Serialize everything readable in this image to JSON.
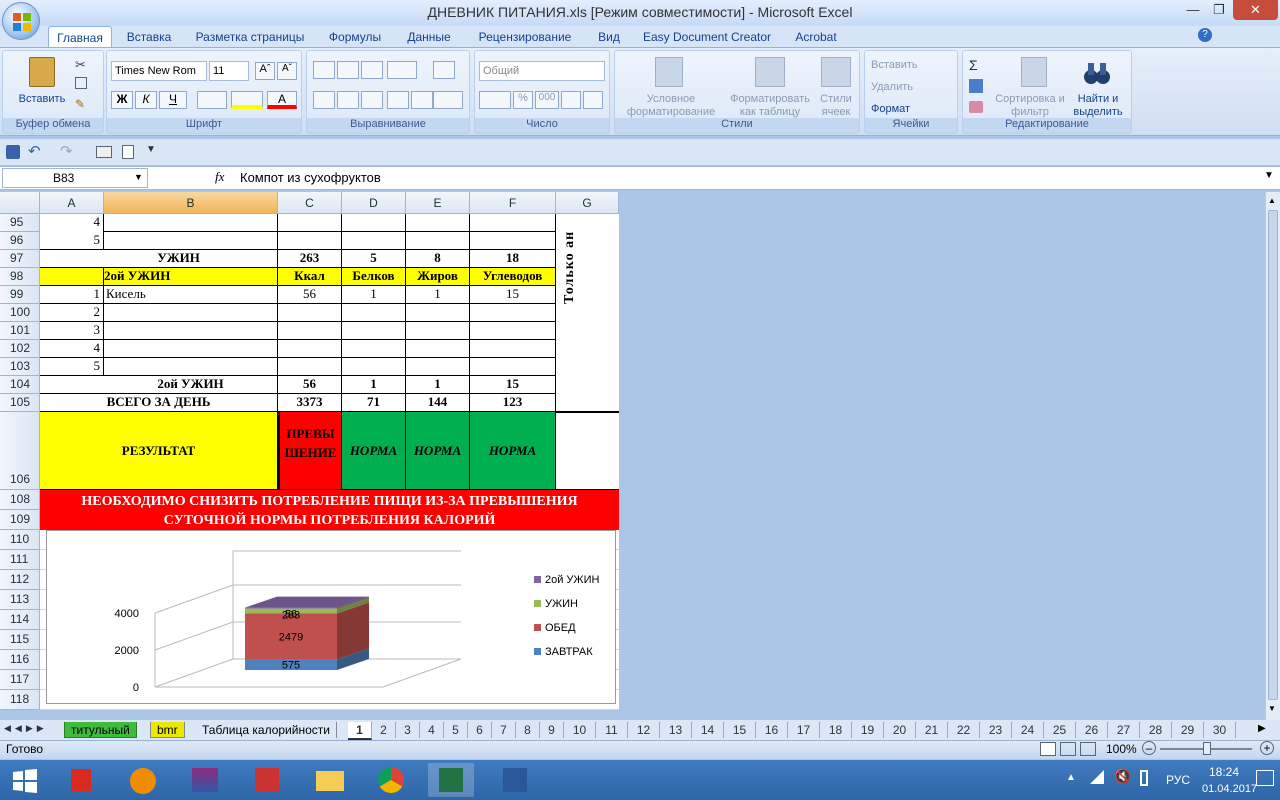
{
  "window": {
    "title": "ДНЕВНИК ПИТАНИЯ.xls  [Режим совместимости] - Microsoft Excel"
  },
  "tabs": [
    "Главная",
    "Вставка",
    "Разметка страницы",
    "Формулы",
    "Данные",
    "Рецензирование",
    "Вид",
    "Easy Document Creator",
    "Acrobat"
  ],
  "ribbon": {
    "paste": "Вставить",
    "clipboard": "Буфер обмена",
    "font_name": "Times New Rom",
    "font_size": "11",
    "font_group": "Шрифт",
    "align_group": "Выравнивание",
    "number_format": "Общий",
    "number_group": "Число",
    "cond_format": "Условное форматирование",
    "format_table": "Форматировать как таблицу",
    "cell_styles": "Стили ячеек",
    "styles_group": "Стили",
    "insert": "Вставить",
    "delete": "Удалить",
    "format": "Формат",
    "cells_group": "Ячейки",
    "sort_filter": "Сортировка и фильтр",
    "find_select": "Найти и выделить",
    "editing_group": "Редактирование"
  },
  "formula_bar": {
    "name_box": "B83",
    "fx": "fx",
    "content": "Компот из сухофруктов"
  },
  "columns": [
    "A",
    "B",
    "C",
    "D",
    "E",
    "F",
    "G"
  ],
  "rows": {
    "r95": {
      "num": "95",
      "a": "4"
    },
    "r96": {
      "num": "96",
      "a": "5"
    },
    "r97": {
      "num": "97",
      "b": "УЖИН",
      "c": "263",
      "d": "5",
      "e": "8",
      "f": "18"
    },
    "r98": {
      "num": "98",
      "b": "2ой УЖИН",
      "c": "Ккал",
      "d": "Белков",
      "e": "Жиров",
      "f": "Углеводов"
    },
    "r99": {
      "num": "99",
      "a": "1",
      "b": "Кисель",
      "c": "56",
      "d": "1",
      "e": "1",
      "f": "15"
    },
    "r100": {
      "num": "100",
      "a": "2"
    },
    "r101": {
      "num": "101",
      "a": "3"
    },
    "r102": {
      "num": "102",
      "a": "4"
    },
    "r103": {
      "num": "103",
      "a": "5"
    },
    "r104": {
      "num": "104",
      "b": "2ой УЖИН",
      "c": "56",
      "d": "1",
      "e": "1",
      "f": "15"
    },
    "r105": {
      "num": "105",
      "b": "ВСЕГО ЗА ДЕНЬ",
      "c": "3373",
      "d": "71",
      "e": "144",
      "f": "123"
    },
    "r106": {
      "num": "106",
      "b": "РЕЗУЛЬТАТ",
      "c": "ПРЕВЫШЕНИЕ",
      "d": "НОРМА",
      "e": "НОРМА",
      "f": "НОРМА"
    },
    "r108": {
      "num": "108"
    },
    "r109": {
      "num": "109"
    },
    "warning": "НЕОБХОДИМО СНИЗИТЬ ПОТРЕБЛЕНИЕ ПИЩИ ИЗ-ЗА ПРЕВЫШЕНИЯ СУТОЧНОЙ НОРМЫ ПОТРЕБЛЕНИЯ КАЛОРИЙ",
    "g_vertical": "Только ан",
    "chart_rows": [
      "110",
      "111",
      "112",
      "113",
      "114",
      "115",
      "116",
      "117",
      "118"
    ]
  },
  "chart_data": {
    "type": "bar",
    "stacked": true,
    "three_d": true,
    "categories": [
      ""
    ],
    "series": [
      {
        "name": "ЗАВТРАК",
        "values": [
          575
        ],
        "color": "#4f81bd"
      },
      {
        "name": "ОБЕД",
        "values": [
          2479
        ],
        "color": "#c0504d"
      },
      {
        "name": "УЖИН",
        "values": [
          263
        ],
        "color": "#9bbb59"
      },
      {
        "name": "2ой УЖИН",
        "values": [
          56
        ],
        "color": "#8064a2"
      }
    ],
    "yticks": [
      "0",
      "2000",
      "4000"
    ],
    "ylim": [
      0,
      4000
    ],
    "legend": "right"
  },
  "sheet_tabs": [
    "титульный",
    "bmr",
    "Таблица калорийности",
    "1",
    "2",
    "3",
    "4",
    "5",
    "6",
    "7",
    "8",
    "9",
    "10",
    "11",
    "12",
    "13",
    "14",
    "15",
    "16",
    "17",
    "18",
    "19",
    "20",
    "21",
    "22",
    "23",
    "24",
    "25",
    "26",
    "27",
    "28",
    "29",
    "30"
  ],
  "status": {
    "ready": "Готово",
    "zoom": "100%"
  },
  "tray": {
    "lang": "РУС",
    "time": "18:24",
    "date": "01.04.2017"
  }
}
